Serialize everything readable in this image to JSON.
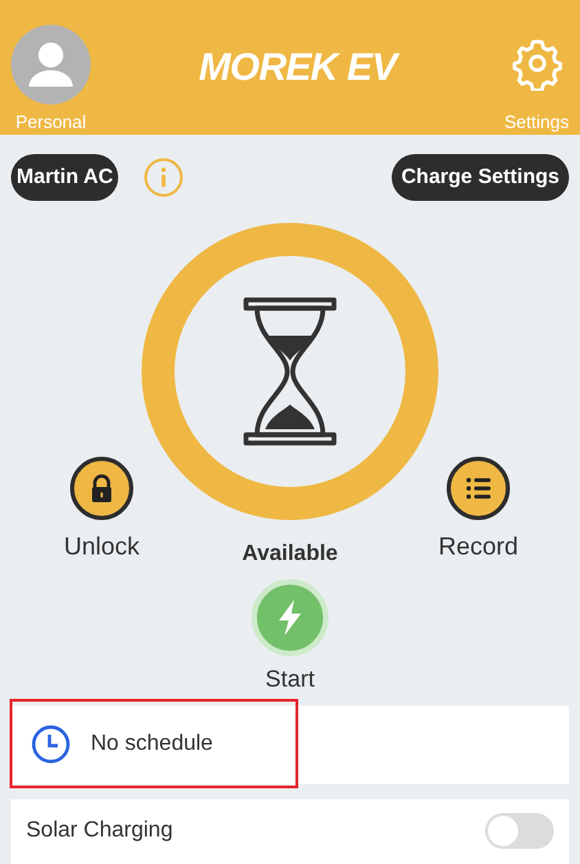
{
  "header": {
    "profile_label": "Personal",
    "logo": "MOREK EV",
    "settings_label": "Settings"
  },
  "charger_name": "Martin AC",
  "charge_settings": "Charge Settings",
  "status": "Available",
  "actions": [
    {
      "kind": "lock",
      "label": "Unlock"
    },
    {
      "kind": "list",
      "label": "Record"
    }
  ],
  "start": {
    "label": "Start"
  },
  "schedule": {
    "text": "No schedule",
    "highlighted": true
  },
  "solar_charging": {
    "label": "Solar Charging",
    "on": false
  }
}
